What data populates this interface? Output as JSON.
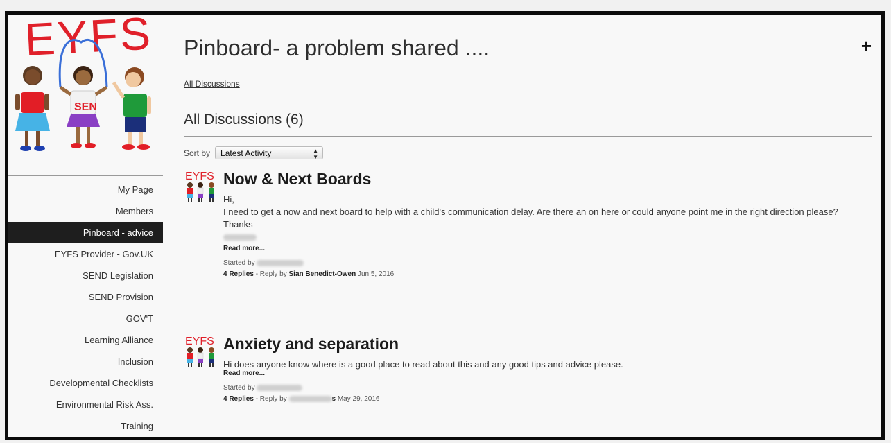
{
  "logo": {
    "title": "EYFS",
    "badge": "SEN",
    "colors": {
      "title": "#e0202a",
      "skipping_rope": "#3a6fd8"
    }
  },
  "sidebar": {
    "items": [
      {
        "label": "My Page",
        "active": false
      },
      {
        "label": "Members",
        "active": false
      },
      {
        "label": "Pinboard - advice",
        "active": true
      },
      {
        "label": "EYFS Provider - Gov.UK",
        "active": false
      },
      {
        "label": "SEND Legislation",
        "active": false
      },
      {
        "label": "SEND Provision",
        "active": false
      },
      {
        "label": "GOV'T",
        "active": false
      },
      {
        "label": "Learning Alliance",
        "active": false
      },
      {
        "label": "Inclusion",
        "active": false
      },
      {
        "label": "Developmental Checklists",
        "active": false
      },
      {
        "label": "Environmental Risk Ass.",
        "active": false
      },
      {
        "label": "Training",
        "active": false
      }
    ]
  },
  "header": {
    "title": "Pinboard- a problem shared ....",
    "add_label": "+"
  },
  "breadcrumb": "All Discussions",
  "section": {
    "title": "All Discussions (6)"
  },
  "sort": {
    "label": "Sort by",
    "selected": "Latest Activity",
    "arrows": "▲▼"
  },
  "avatar_label": "EYFS",
  "discussions": [
    {
      "title": "Now & Next Boards",
      "lines": [
        "Hi,",
        "I need to get a now and next board to help with a child's communication delay. Are there an on here or could anyone point me in the right direction please?",
        "Thanks"
      ],
      "read_more": "Read more...",
      "started_by_label": "Started by",
      "replies": "4 Replies",
      "reply_by_label": " - Reply by ",
      "reply_by": "Sian Benedict-Owen",
      "date": "Jun 5, 2016"
    },
    {
      "title": "Anxiety and separation",
      "lines": [
        "Hi does anyone know where is a good place to read about this and any good tips and advice please."
      ],
      "read_more": "Read more...",
      "started_by_label": "Started by",
      "replies": "4 Replies",
      "reply_by_label": " - Reply by ",
      "reply_by_suffix": "s",
      "date": "May 29, 2016"
    }
  ]
}
